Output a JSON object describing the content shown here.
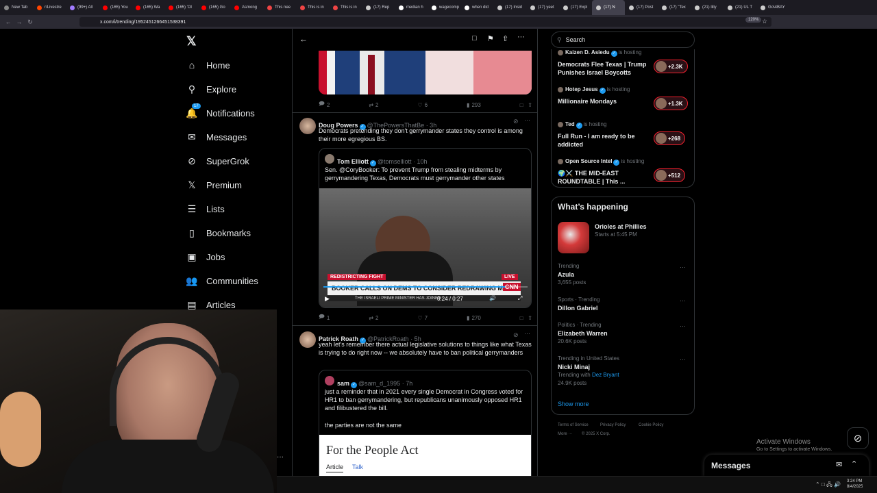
{
  "browser": {
    "tabs": [
      "New Tab",
      "r/Livestre",
      "(99+) All",
      "(165) You",
      "(165) Wa",
      "(165) 'Ol",
      "(165) Go",
      "Asmong",
      "This nee",
      "This is in",
      "This is in",
      "(17) Rep",
      "median h",
      "wagecomp",
      "when did",
      "(17) Insid",
      "(17) yeet",
      "(17) Expl",
      "(17) N",
      "(17) Post",
      "(17) \"Tex",
      "(21) lilly",
      "(21) UL T",
      "Go\\4BAY"
    ],
    "url": "x.com/i/trending/1952451266451538391",
    "zoom": "120%"
  },
  "nav": {
    "items": [
      {
        "label": "Home",
        "icon": "home-icon"
      },
      {
        "label": "Explore",
        "icon": "search-icon"
      },
      {
        "label": "Notifications",
        "icon": "bell-icon",
        "badge": "17"
      },
      {
        "label": "Messages",
        "icon": "envelope-icon"
      },
      {
        "label": "SuperGrok",
        "icon": "grok-icon"
      },
      {
        "label": "Premium",
        "icon": "x-logo-icon"
      },
      {
        "label": "Lists",
        "icon": "list-icon"
      },
      {
        "label": "Bookmarks",
        "icon": "bookmark-icon"
      },
      {
        "label": "Jobs",
        "icon": "briefcase-icon"
      },
      {
        "label": "Communities",
        "icon": "people-icon"
      },
      {
        "label": "Articles",
        "icon": "article-icon"
      }
    ]
  },
  "feed": {
    "top_post_actions": {
      "replies": "2",
      "reposts": "2",
      "likes": "6",
      "views": "293"
    },
    "post1": {
      "name": "Doug Powers",
      "handle": "@ThePowersThatBe · 3h",
      "text": "Democrats pretending they don't gerrymander states they control is among their more egregious BS.",
      "quote": {
        "name": "Tom Elliott",
        "handle": "@tomselliott · 10h",
        "text": "Sen. @CoryBooker: To prevent Trump from stealing midterms by gerrymandering Texas, Democrats must gerrymander other states",
        "video": {
          "tag": "REDISTRICTING FIGHT",
          "live": "LIVE",
          "headline": "BOOKER CALLS ON DEMS TO CONSIDER REDRAWING MAPS",
          "ticker": "THE ISRAELI PRIME MINISTER HAS JOINED",
          "network": "CNN",
          "time": "0:24 / 0:27"
        }
      },
      "actions": {
        "replies": "1",
        "reposts": "2",
        "likes": "7",
        "views": "270"
      }
    },
    "post2": {
      "name": "Patrick Roath",
      "handle": "@PatrickRoath · 5h",
      "text": "yeah let's remember there actual legislative solutions to things like what Texas is trying to do right now  -- we absolutely have to ban political gerrymanders",
      "quote": {
        "name": "sam",
        "handle": "@sam_d_1995 · 7h",
        "text": "just a reminder that in 2021 every single Democrat in Congress voted for HR1 to ban gerrymandering, but republicans unanimously opposed HR1 and filibustered the bill.",
        "text2": "the parties are not the same",
        "article_title": "For the People Act",
        "article_tabs": [
          "Article",
          "Talk"
        ]
      }
    }
  },
  "right": {
    "search_placeholder": "Search",
    "spaces": [
      {
        "host": "Kaizen D. Asiedu",
        "status": "is hosting",
        "title": "Democrats Flee Texas | Trump Punishes Israel Boycotts",
        "count": "+2.3K"
      },
      {
        "host": "Hotep Jesus",
        "status": "is hosting",
        "title": "Millionaire Mondays",
        "count": "+1.3K"
      },
      {
        "host": "Ted",
        "status": "is hosting",
        "title": "Full Run - I am ready to be addicted",
        "count": "+268"
      },
      {
        "host": "Open Source Intel",
        "status": "is hosting",
        "title": "🌍⚔️ THE MID-EAST ROUNDTABLE | This ...",
        "count": "+512"
      }
    ],
    "happening_title": "What’s happening",
    "featured": {
      "title": "Orioles at Phillies",
      "subtitle": "Starts at 5:45 PM"
    },
    "trends": [
      {
        "context": "Trending",
        "name": "Azula",
        "posts": "3,655 posts"
      },
      {
        "context": "Sports · Trending",
        "name": "Dillon Gabriel",
        "posts": ""
      },
      {
        "context": "Politics · Trending",
        "name": "Elizabeth Warren",
        "posts": "20.6K posts"
      },
      {
        "context": "Trending in United States",
        "name": "Nicki Minaj",
        "with_label": "Trending with",
        "with_link": "Dez Bryant",
        "posts": "24.9K posts"
      }
    ],
    "show_more": "Show more",
    "footer": [
      "Terms of Service",
      "Privacy Policy",
      "Cookie Policy",
      "More ···",
      "© 2025 X Corp."
    ],
    "activate": {
      "title": "Activate Windows",
      "subtitle": "Go to Settings to activate Windows."
    },
    "messages_label": "Messages"
  },
  "taskbar": {
    "time": "3:24 PM",
    "date": "8/4/2025"
  },
  "colors": {
    "accent": "#1d9bf0",
    "background": "#000000",
    "border": "#2f3336",
    "muted": "#71767b",
    "live_red": "#f4212e"
  }
}
